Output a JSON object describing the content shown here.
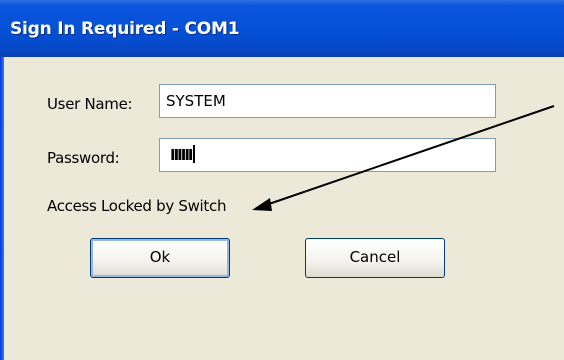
{
  "window": {
    "title": "Sign In Required - COM1"
  },
  "form": {
    "username_label": "User Name:",
    "username_value": "SYSTEM",
    "password_label": "Password:",
    "password_masked": "IIIIII",
    "status_message": "Access Locked by Switch"
  },
  "buttons": {
    "ok_label": "Ok",
    "cancel_label": "Cancel"
  },
  "colors": {
    "titlebar": "#0551d6",
    "dialog_background": "#ece9d8",
    "button_border": "#003c74",
    "field_border": "#7f9db9",
    "annotation_arrow": "#000000"
  }
}
